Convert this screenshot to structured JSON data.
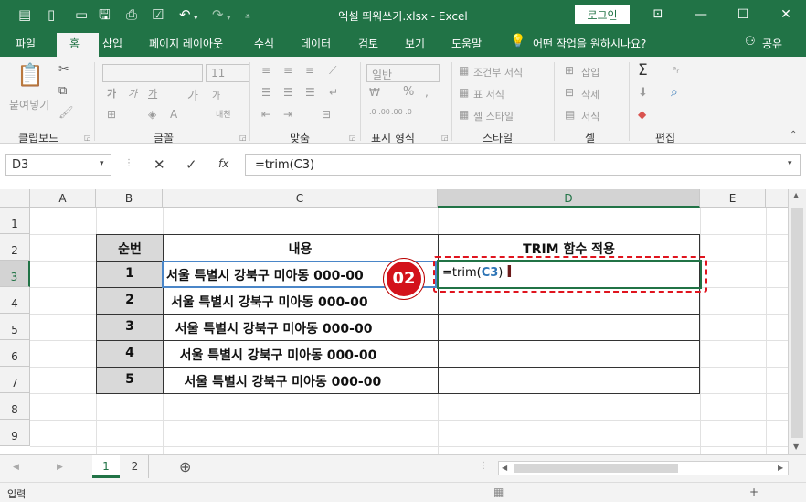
{
  "window": {
    "title": "엑셀 띄워쓰기.xlsx  -  Excel",
    "login_label": "로그인",
    "minimize": "—",
    "restore": "☐",
    "close": "✕"
  },
  "ribbon_tabs": [
    "파일",
    "홈",
    "삽입",
    "페이지 레이아웃",
    "수식",
    "데이터",
    "검토",
    "보기",
    "도움말"
  ],
  "tell_me": "어떤 작업을 원하시나요?",
  "share": "공유",
  "ribbon": {
    "clipboard": {
      "paste": "붙여넣기",
      "label": "클립보드"
    },
    "font": {
      "size": "11",
      "label": "글꼴",
      "bold": "가",
      "italic": "가",
      "underline": "가",
      "grow": "가",
      "shrink": "가",
      "phonetic": "내천"
    },
    "alignment": {
      "label": "맞춤"
    },
    "number": {
      "format": "일반",
      "label": "표시 형식",
      "percent": "%",
      "inc": ".0 .00",
      "dec": ".00 .0"
    },
    "styles": {
      "conditional": "조건부 서식",
      "table": "표 서식",
      "cell": "셀 스타일",
      "label": "스타일"
    },
    "cells": {
      "insert": "삽입",
      "delete": "삭제",
      "format": "서식",
      "label": "셀"
    },
    "editing": {
      "label": "편집",
      "sum": "Σ",
      "sort": "ᵃᵣ",
      "find": "⌕"
    }
  },
  "formula_bar": {
    "name_box": "D3",
    "cancel": "✕",
    "enter": "✓",
    "fx": "fx",
    "formula": "=trim(C3)"
  },
  "columns": [
    "A",
    "B",
    "C",
    "D",
    "E"
  ],
  "rows": [
    "1",
    "2",
    "3",
    "4",
    "5",
    "6",
    "7",
    "8",
    "9"
  ],
  "table": {
    "headers": [
      "순번",
      "내용",
      "TRIM 함수 적용"
    ],
    "rows": [
      {
        "num": "1",
        "content": "서울 특별시 강북구 미아동 000-00"
      },
      {
        "num": "2",
        "content": " 서울 특별시 강북구 미아동 000-00"
      },
      {
        "num": "3",
        "content": "  서울 특별시 강북구 미아동 000-00"
      },
      {
        "num": "4",
        "content": "   서울 특별시 강북구 미아동 000-00"
      },
      {
        "num": "5",
        "content": "    서울 특별시 강북구 미아동 000-00"
      }
    ],
    "edit": {
      "prefix": "=trim(",
      "ref": "C3",
      "suffix": ")"
    }
  },
  "badge": "02",
  "sheets": [
    "1",
    "2"
  ],
  "status": "입력",
  "colors": {
    "excel_green": "#217346",
    "ref_blue": "#2e75b6",
    "badge_red": "#d3121b",
    "highlight_dash": "#e0141e"
  }
}
